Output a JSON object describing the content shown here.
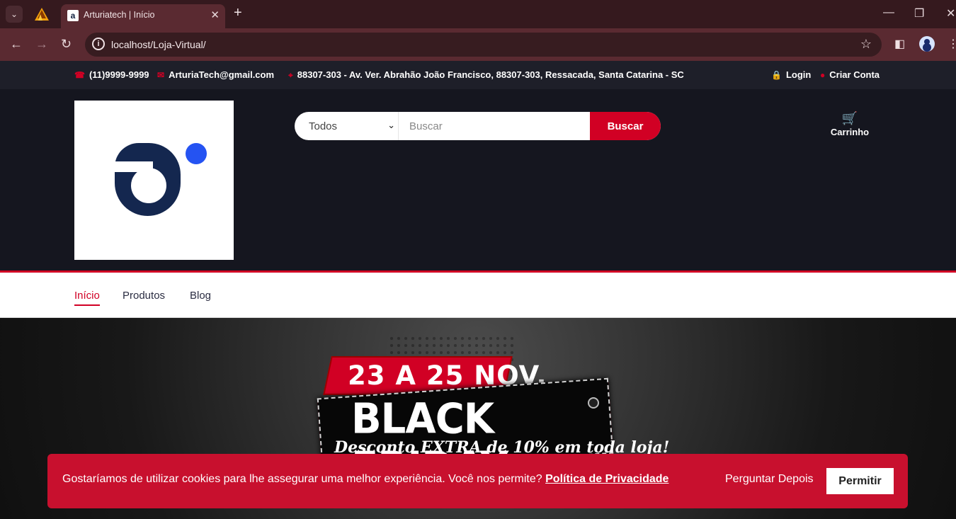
{
  "browser": {
    "tab_title": "Arturiatech | Início",
    "favicon_text": "a",
    "url": "localhost/Loja-Virtual/",
    "new_tab": "+",
    "close_tab": "✕",
    "dropdown_icon": "⌄",
    "back_icon": "←",
    "forward_icon": "→",
    "reload_icon": "↻",
    "bookmark_icon": "☆",
    "sidebar_icon": "◧",
    "menu_icon": "⋮",
    "minimize_icon": "—",
    "restore_icon": "❐",
    "window_close_icon": "✕"
  },
  "topbar": {
    "phone": "(11)9999-9999",
    "email": "ArturiaTech@gmail.com",
    "address": "88307-303 - Av. Ver. Abrahão João Francisco, 88307-303, Ressacada, Santa Catarina - SC",
    "login": "Login",
    "create_account": "Criar Conta",
    "phone_icon": "☎",
    "email_icon": "✉",
    "map_icon": "⌖",
    "lock_icon": "🔒",
    "user_icon": "●"
  },
  "header": {
    "category_selected": "Todos",
    "category_arrow": "⌄",
    "search_placeholder": "Buscar",
    "search_button": "Buscar",
    "cart_label": "Carrinho",
    "cart_icon": "🛒",
    "brand_color": "#d10024"
  },
  "navigation": {
    "items": [
      "Início",
      "Produtos",
      "Blog"
    ]
  },
  "banner": {
    "date_range": "23 A 25 NOV.",
    "headline": "BLACK FRIDAY",
    "subtitle": "Desconto EXTRA de 10% em toda loja!"
  },
  "cookie": {
    "message": "Gostaríamos de utilizar cookies para lhe assegurar uma melhor experiência. Você nos permite?",
    "policy_link": "Política de Privacidade",
    "ask_later": "Perguntar Depois",
    "allow": "Permitir"
  }
}
